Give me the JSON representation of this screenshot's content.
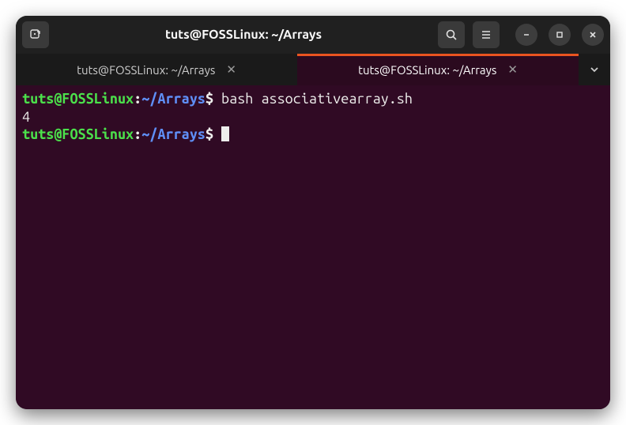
{
  "titlebar": {
    "title": "tuts@FOSSLinux: ~/Arrays"
  },
  "tabs": [
    {
      "label": "tuts@FOSSLinux: ~/Arrays",
      "active": false
    },
    {
      "label": "tuts@FOSSLinux: ~/Arrays",
      "active": true
    }
  ],
  "prompt": {
    "user_host": "tuts@FOSSLinux",
    "colon": ":",
    "path": "~/Arrays",
    "dollar": "$"
  },
  "lines": {
    "cmd1": "bash associativearray.sh",
    "out1": "4"
  }
}
